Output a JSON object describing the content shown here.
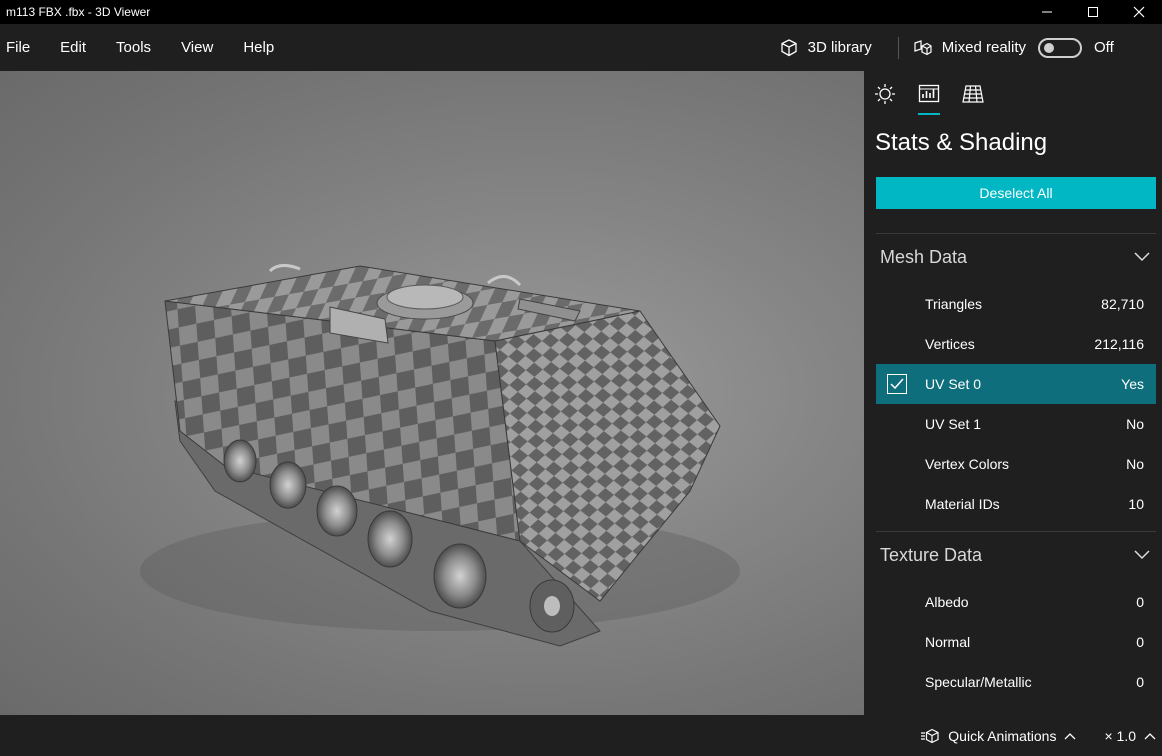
{
  "window": {
    "title": "m113 FBX .fbx - 3D Viewer",
    "minimize_icon": "minimize-icon",
    "maximize_icon": "maximize-icon",
    "close_icon": "close-icon"
  },
  "menu": {
    "items": [
      "File",
      "Edit",
      "Tools",
      "View",
      "Help"
    ],
    "library_label": "3D library",
    "mixed_reality_label": "Mixed reality",
    "toggle_state": "Off"
  },
  "panel": {
    "tabs": [
      "lighting-tab",
      "stats-tab",
      "grid-tab"
    ],
    "active_tab": "stats-tab",
    "title": "Stats & Shading",
    "deselect_label": "Deselect All",
    "accent_color": "#00b7c3",
    "selected_row_color": "#0f6e7b",
    "mesh": {
      "title": "Mesh Data",
      "rows": [
        {
          "label": "Triangles",
          "value": "82,710"
        },
        {
          "label": "Vertices",
          "value": "212,116"
        },
        {
          "label": "UV Set 0",
          "value": "Yes",
          "checked": true
        },
        {
          "label": "UV Set 1",
          "value": "No"
        },
        {
          "label": "Vertex Colors",
          "value": "No"
        },
        {
          "label": "Material IDs",
          "value": "10"
        }
      ]
    },
    "texture": {
      "title": "Texture Data",
      "rows": [
        {
          "label": "Albedo",
          "value": "0"
        },
        {
          "label": "Normal",
          "value": "0"
        },
        {
          "label": "Specular/Metallic",
          "value": "0"
        }
      ]
    }
  },
  "status": {
    "animations_label": "Quick Animations",
    "speed_label": "× 1.0"
  }
}
